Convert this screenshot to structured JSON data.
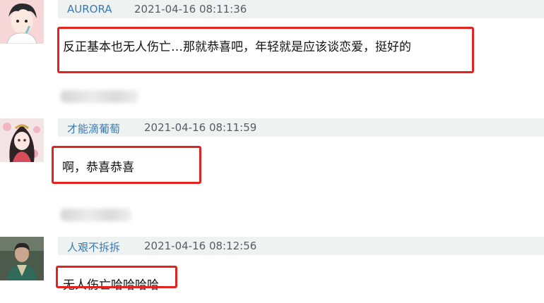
{
  "comments": [
    {
      "username": "AURORA",
      "timestamp": "2021-04-16 08:11:36",
      "text": "反正基本也无人伤亡…那就恭喜吧，年轻就是应该谈恋爱，挺好的",
      "avatar_icon": "anime-boy-avatar"
    },
    {
      "username": "才能滴葡萄",
      "timestamp": "2021-04-16 08:11:59",
      "text": "啊，恭喜恭喜",
      "avatar_icon": "anime-girl-avatar"
    },
    {
      "username": "人艰不拆拆",
      "timestamp": "2021-04-16 08:12:56",
      "text": "无人伤亡哈哈哈哈",
      "avatar_icon": "man-photo-avatar"
    }
  ],
  "colors": {
    "username": "#3b78b0",
    "header_bg": "#eef3f1",
    "highlight": "#e02420"
  }
}
